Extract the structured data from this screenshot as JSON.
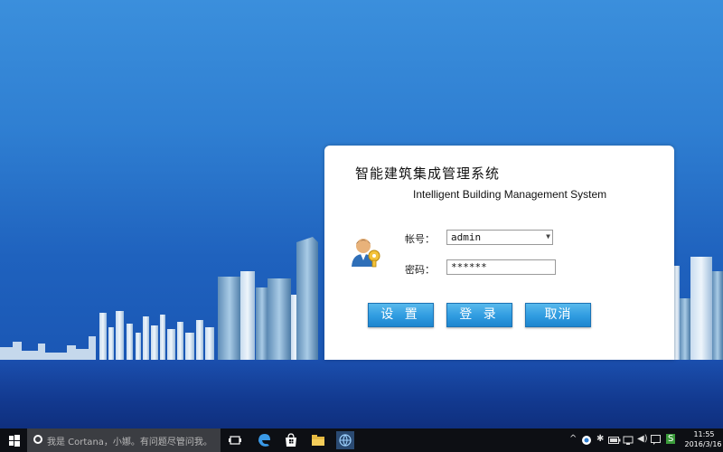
{
  "app": {
    "title_cn": "智能建筑集成管理系统",
    "title_en": "Intelligent Building Management System"
  },
  "form": {
    "account_label": "帐号：",
    "account_value": "admin",
    "password_label": "密码：",
    "password_value": "******"
  },
  "buttons": {
    "settings": "设 置",
    "login": "登 录",
    "cancel": "取消"
  },
  "taskbar": {
    "search_placeholder": "我是 Cortana，小娜。有问题尽管问我。",
    "time": "11:55",
    "date": "2016/3/16",
    "pinned_icons": [
      "task-view-icon",
      "edge-icon",
      "store-icon",
      "file-explorer-icon",
      "network-app-icon"
    ],
    "tray_icons": [
      "chevron-up-icon",
      "onedrive-icon",
      "bluetooth-icon",
      "battery-icon",
      "network-icon",
      "volume-icon",
      "action-center-icon",
      "ime-icon"
    ]
  },
  "colors": {
    "button_blue": "#2f9be0",
    "desktop_blue": "#2f7fd2"
  }
}
